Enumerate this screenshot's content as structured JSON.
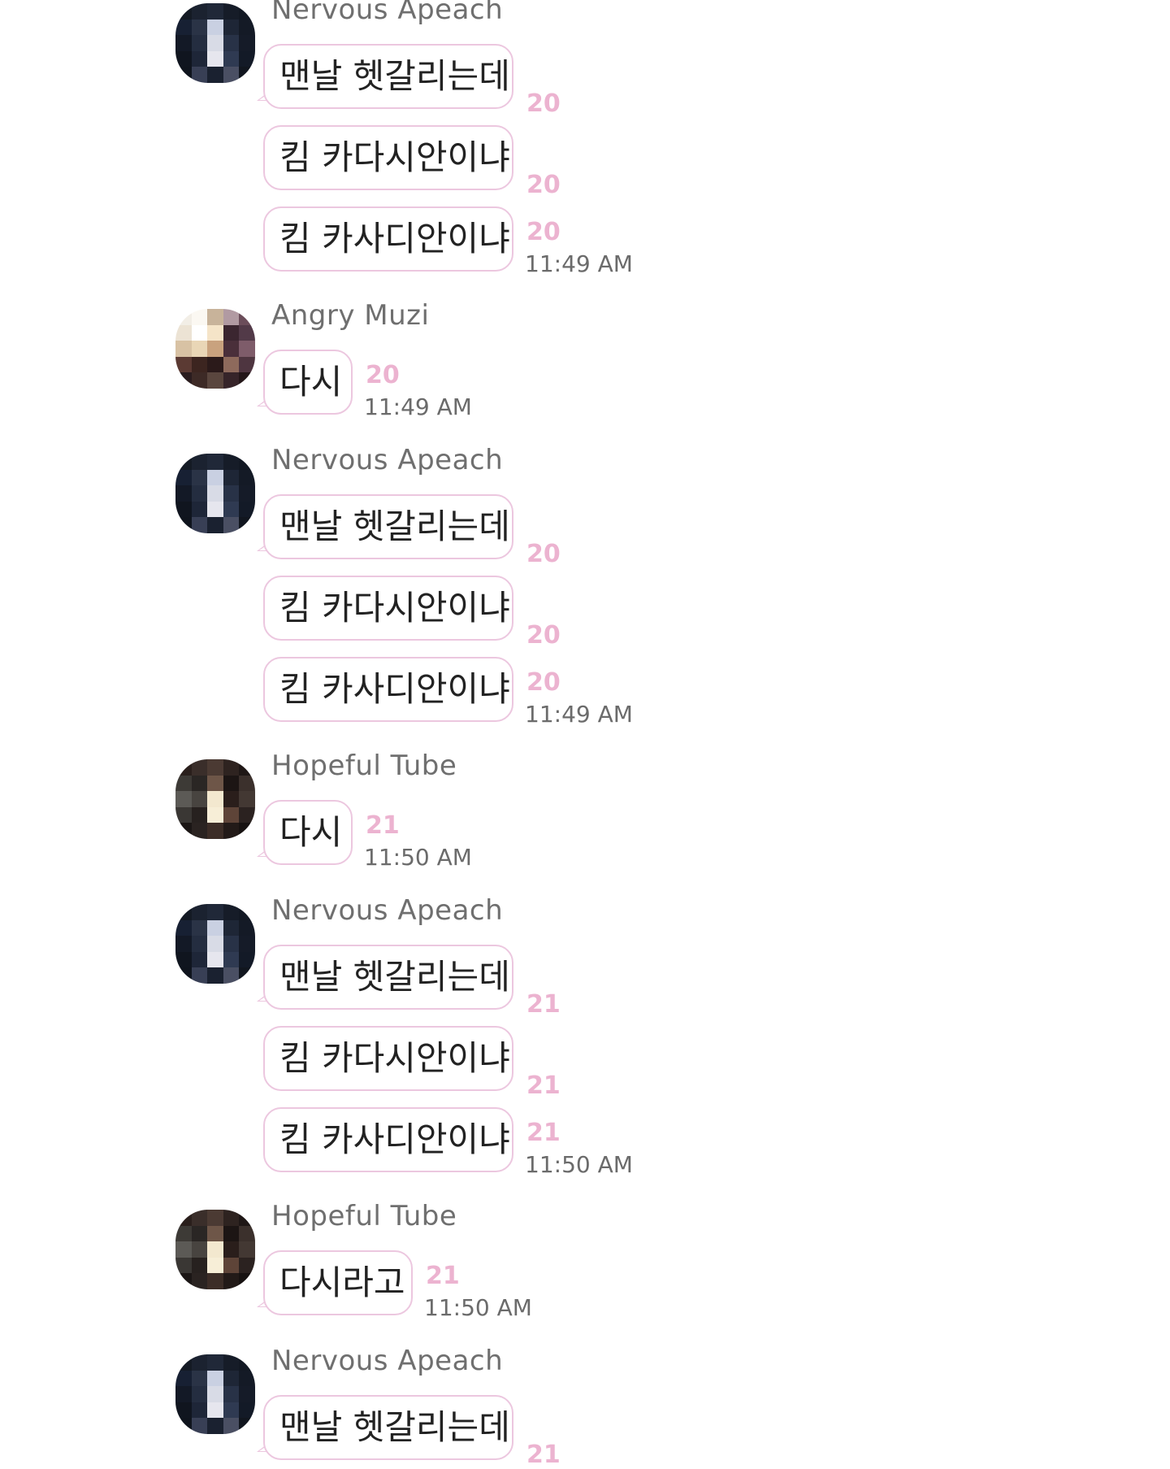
{
  "colors": {
    "bubble_border": "#ecc7df",
    "unread_count": "#ecb3d0",
    "sender_name": "#6f6f6f",
    "timestamp": "#6b6b6b",
    "message_text": "#222222"
  },
  "groups": [
    {
      "sender": "Nervous Apeach",
      "avatar": "pixelated-photo-avatar",
      "messages": [
        {
          "text": "맨날 헷갈리는데",
          "count": "20",
          "time": ""
        },
        {
          "text": "킴 카다시안이냐",
          "count": "20",
          "time": ""
        },
        {
          "text": "킴 카사디안이냐",
          "count": "20",
          "time": "11:49 AM"
        }
      ]
    },
    {
      "sender": "Angry Muzi",
      "avatar": "pixelated-photo-avatar",
      "messages": [
        {
          "text": "다시",
          "count": "20",
          "time": "11:49 AM"
        }
      ]
    },
    {
      "sender": "Nervous Apeach",
      "avatar": "pixelated-photo-avatar",
      "messages": [
        {
          "text": "맨날 헷갈리는데",
          "count": "20",
          "time": ""
        },
        {
          "text": "킴 카다시안이냐",
          "count": "20",
          "time": ""
        },
        {
          "text": "킴 카사디안이냐",
          "count": "20",
          "time": "11:49 AM"
        }
      ]
    },
    {
      "sender": "Hopeful Tube",
      "avatar": "pixelated-photo-avatar",
      "messages": [
        {
          "text": "다시",
          "count": "21",
          "time": "11:50 AM"
        }
      ]
    },
    {
      "sender": "Nervous Apeach",
      "avatar": "pixelated-photo-avatar",
      "messages": [
        {
          "text": "맨날 헷갈리는데",
          "count": "21",
          "time": ""
        },
        {
          "text": "킴 카다시안이냐",
          "count": "21",
          "time": ""
        },
        {
          "text": "킴 카사디안이냐",
          "count": "21",
          "time": "11:50 AM"
        }
      ]
    },
    {
      "sender": "Hopeful Tube",
      "avatar": "pixelated-photo-avatar",
      "messages": [
        {
          "text": "다시라고",
          "count": "21",
          "time": "11:50 AM"
        }
      ]
    },
    {
      "sender": "Nervous Apeach",
      "avatar": "pixelated-photo-avatar",
      "messages": [
        {
          "text": "맨날 헷갈리는데",
          "count": "21",
          "time": ""
        }
      ]
    }
  ]
}
